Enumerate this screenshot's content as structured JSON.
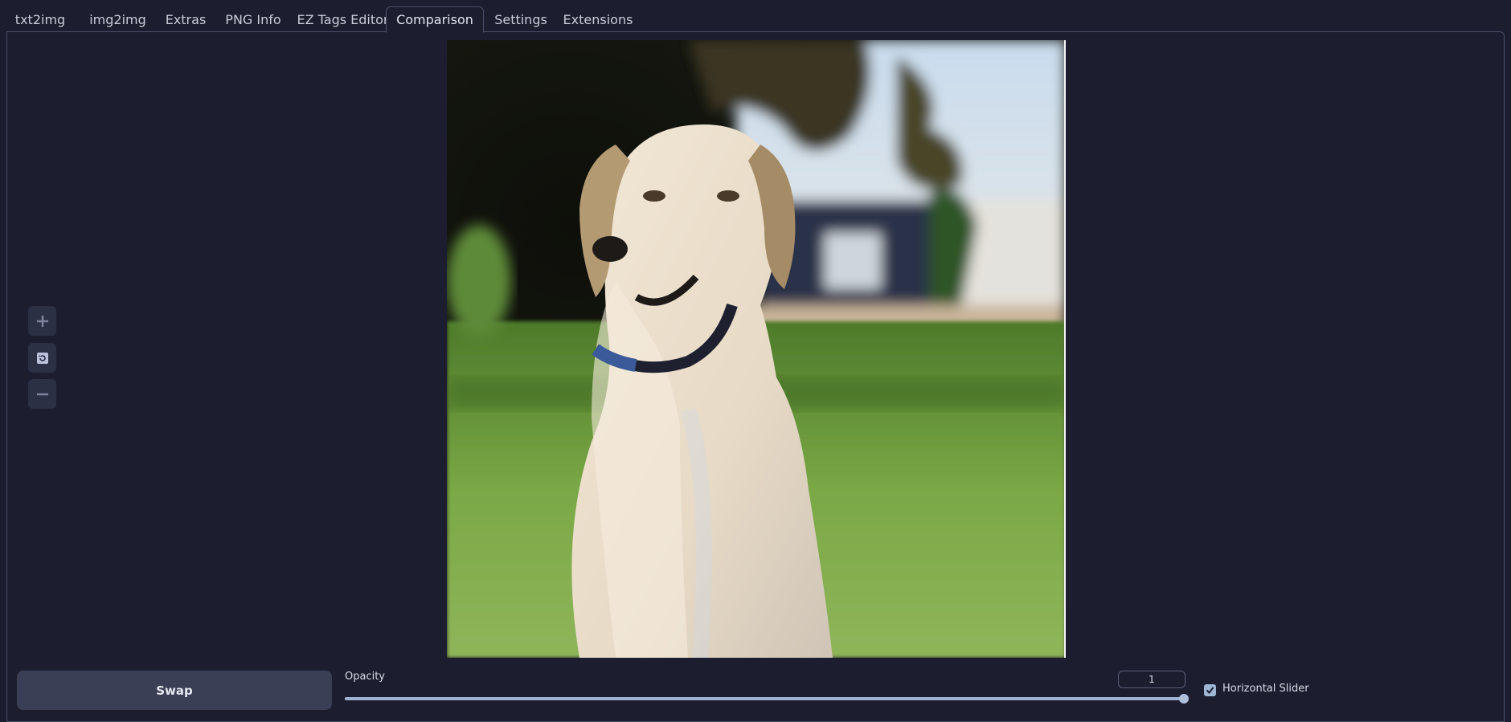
{
  "tabs": [
    {
      "label": "txt2img",
      "active": false
    },
    {
      "label": "img2img",
      "active": false
    },
    {
      "label": "Extras",
      "active": false
    },
    {
      "label": "PNG Info",
      "active": false
    },
    {
      "label": "EZ Tags Editor",
      "active": false
    },
    {
      "label": "Comparison",
      "active": true
    },
    {
      "label": "Settings",
      "active": false
    },
    {
      "label": "Extensions",
      "active": false
    }
  ],
  "zoom_controls": {
    "zoom_in_icon": "plus-icon",
    "reset_icon": "reset-icon",
    "zoom_out_icon": "minus-icon"
  },
  "controls": {
    "swap_label": "Swap",
    "opacity_label": "Opacity",
    "opacity_value": "1",
    "opacity_fraction": 1,
    "horizontal_slider_label": "Horizontal Slider",
    "horizontal_slider_checked": true
  },
  "colors": {
    "background": "#1c1e30",
    "accent": "#9fb2d1",
    "button": "#3b3f56"
  }
}
